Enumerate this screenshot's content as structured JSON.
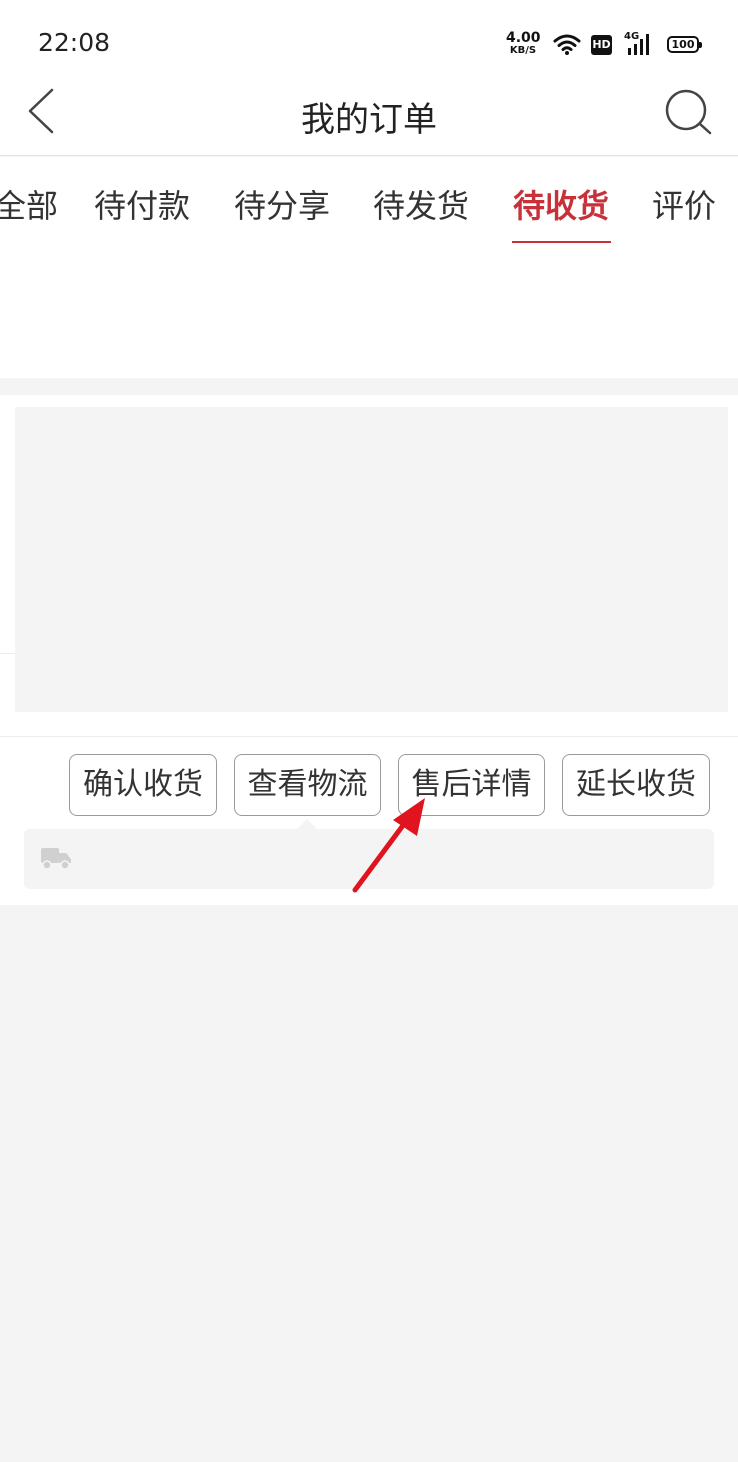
{
  "status_bar": {
    "time": "22:08",
    "net_speed_value": "4.00",
    "net_speed_unit": "KB/S",
    "hd_label": "HD",
    "signal_label": "4G",
    "battery_level": "100"
  },
  "header": {
    "title": "我的订单",
    "back_icon": "chevron-left-icon",
    "search_icon": "search-icon"
  },
  "tabs": [
    {
      "label": "全部"
    },
    {
      "label": "待付款"
    },
    {
      "label": "待分享"
    },
    {
      "label": "待发货"
    },
    {
      "label": "待收货",
      "active": true
    },
    {
      "label": "评价"
    }
  ],
  "order": {
    "actions": [
      {
        "label": "确认收货"
      },
      {
        "label": "查看物流"
      },
      {
        "label": "售后详情"
      },
      {
        "label": "延长收货"
      }
    ],
    "logistics_icon": "truck-icon"
  },
  "colors": {
    "accent": "#c8303a",
    "annotation": "#e0141e",
    "background": "#f4f4f4"
  }
}
